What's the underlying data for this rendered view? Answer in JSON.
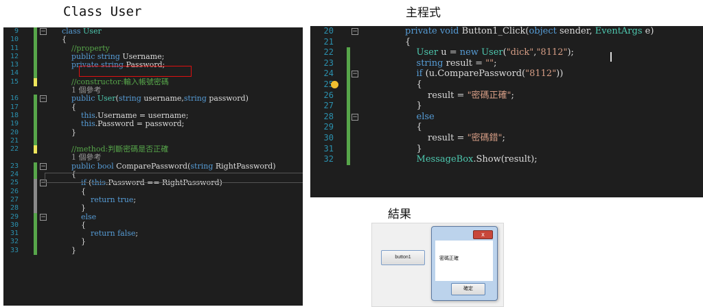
{
  "captions": {
    "left": "Class User",
    "right": "主程式",
    "result": "結果"
  },
  "left_editor": {
    "lines": [
      {
        "n": "9",
        "gutter": "green",
        "fold": "minus",
        "code": [
          [
            "k",
            "class "
          ],
          [
            "t",
            "User"
          ]
        ]
      },
      {
        "n": "10",
        "gutter": "green",
        "fold": "",
        "code": [
          [
            "p",
            "{"
          ]
        ]
      },
      {
        "n": "11",
        "gutter": "green",
        "fold": "",
        "code": [
          [
            "c",
            "    //property"
          ]
        ]
      },
      {
        "n": "12",
        "gutter": "green",
        "fold": "",
        "code": [
          [
            "k",
            "    public string "
          ],
          [
            "p",
            "Username;"
          ]
        ]
      },
      {
        "n": "13",
        "gutter": "green",
        "fold": "",
        "code": [
          [
            "k",
            "    private string "
          ],
          [
            "p",
            "Password;"
          ]
        ]
      },
      {
        "n": "14",
        "gutter": "green",
        "fold": "",
        "code": [
          [
            "p",
            ""
          ]
        ]
      },
      {
        "n": "15",
        "gutter": "yellow",
        "fold": "",
        "code": [
          [
            "c",
            "    //constructor:輸入帳號密碼"
          ]
        ]
      },
      {
        "n": "",
        "gutter": "",
        "fold": "",
        "code": [
          [
            "ref",
            "    1 個參考"
          ]
        ]
      },
      {
        "n": "16",
        "gutter": "green",
        "fold": "minus",
        "code": [
          [
            "k",
            "    public "
          ],
          [
            "t",
            "User"
          ],
          [
            "p",
            "("
          ],
          [
            "k",
            "string "
          ],
          [
            "p",
            "username,"
          ],
          [
            "k",
            "string "
          ],
          [
            "p",
            "password)"
          ]
        ]
      },
      {
        "n": "17",
        "gutter": "green",
        "fold": "",
        "code": [
          [
            "p",
            "    {"
          ]
        ]
      },
      {
        "n": "18",
        "gutter": "green",
        "fold": "",
        "code": [
          [
            "k",
            "        this"
          ],
          [
            "p",
            ".Username = username;"
          ]
        ]
      },
      {
        "n": "19",
        "gutter": "green",
        "fold": "",
        "code": [
          [
            "k",
            "        this"
          ],
          [
            "p",
            ".Password = password;"
          ]
        ]
      },
      {
        "n": "20",
        "gutter": "green",
        "fold": "",
        "code": [
          [
            "p",
            "    }"
          ]
        ]
      },
      {
        "n": "21",
        "gutter": "green",
        "fold": "",
        "code": [
          [
            "p",
            ""
          ]
        ]
      },
      {
        "n": "22",
        "gutter": "yellow",
        "fold": "",
        "code": [
          [
            "c",
            "    //method:判斷密碼是否正確"
          ]
        ]
      },
      {
        "n": "",
        "gutter": "",
        "fold": "",
        "code": [
          [
            "ref",
            "    1 個參考"
          ]
        ]
      },
      {
        "n": "23",
        "gutter": "green",
        "fold": "minus",
        "code": [
          [
            "k",
            "    public bool "
          ],
          [
            "p",
            "ComparePassword("
          ],
          [
            "k",
            "string "
          ],
          [
            "p",
            "RightPassword)"
          ]
        ]
      },
      {
        "n": "24",
        "gutter": "green",
        "fold": "",
        "code": [
          [
            "p",
            "    {"
          ]
        ]
      },
      {
        "n": "25",
        "gutter": "gray",
        "fold": "minus",
        "code": [
          [
            "k",
            "        if "
          ],
          [
            "p",
            "("
          ],
          [
            "k",
            "this"
          ],
          [
            "p",
            ".Password == RightPassword)"
          ]
        ]
      },
      {
        "n": "26",
        "gutter": "gray",
        "fold": "",
        "code": [
          [
            "p",
            "        {"
          ]
        ]
      },
      {
        "n": "27",
        "gutter": "gray",
        "fold": "",
        "code": [
          [
            "k",
            "            return true"
          ],
          [
            "p",
            ";"
          ]
        ]
      },
      {
        "n": "28",
        "gutter": "gray",
        "fold": "",
        "code": [
          [
            "p",
            "        }"
          ]
        ]
      },
      {
        "n": "29",
        "gutter": "green",
        "fold": "minus",
        "code": [
          [
            "k",
            "        else"
          ]
        ]
      },
      {
        "n": "30",
        "gutter": "green",
        "fold": "",
        "code": [
          [
            "p",
            "        {"
          ]
        ]
      },
      {
        "n": "31",
        "gutter": "green",
        "fold": "",
        "code": [
          [
            "k",
            "            return false"
          ],
          [
            "p",
            ";"
          ]
        ]
      },
      {
        "n": "32",
        "gutter": "green",
        "fold": "",
        "code": [
          [
            "p",
            "        }"
          ]
        ]
      },
      {
        "n": "33",
        "gutter": "green",
        "fold": "",
        "code": [
          [
            "p",
            "    }"
          ]
        ]
      }
    ]
  },
  "right_editor": {
    "lines": [
      {
        "n": "20",
        "gutter": "",
        "fold": "minus",
        "code": [
          [
            "k",
            "private void "
          ],
          [
            "p",
            "Button1_Click("
          ],
          [
            "k",
            "object "
          ],
          [
            "p",
            "sender, "
          ],
          [
            "t",
            "EventArgs "
          ],
          [
            "p",
            "e)"
          ]
        ]
      },
      {
        "n": "21",
        "gutter": "",
        "fold": "",
        "code": [
          [
            "p",
            "{"
          ]
        ]
      },
      {
        "n": "22",
        "gutter": "green",
        "fold": "",
        "code": [
          [
            "t",
            "    User "
          ],
          [
            "p",
            "u = "
          ],
          [
            "k",
            "new "
          ],
          [
            "t",
            "User"
          ],
          [
            "p",
            "("
          ],
          [
            "s",
            "\"dick\""
          ],
          [
            "p",
            ","
          ],
          [
            "s",
            "\"8112\""
          ],
          [
            "p",
            ");"
          ]
        ]
      },
      {
        "n": "23",
        "gutter": "green",
        "fold": "",
        "code": [
          [
            "k",
            "    string "
          ],
          [
            "p",
            "result = "
          ],
          [
            "s",
            "\"\""
          ],
          [
            "p",
            ";"
          ]
        ]
      },
      {
        "n": "24",
        "gutter": "green",
        "fold": "minus",
        "code": [
          [
            "k",
            "    if "
          ],
          [
            "p",
            "(u.ComparePassword("
          ],
          [
            "s",
            "\"8112\""
          ],
          [
            "p",
            "))"
          ]
        ]
      },
      {
        "n": "25",
        "gutter": "green",
        "fold": "",
        "code": [
          [
            "p",
            "    {"
          ]
        ]
      },
      {
        "n": "26",
        "gutter": "green",
        "fold": "",
        "code": [
          [
            "p",
            "        result = "
          ],
          [
            "s",
            "\"密碼正確\""
          ],
          [
            "p",
            ";"
          ]
        ]
      },
      {
        "n": "27",
        "gutter": "green",
        "fold": "",
        "code": [
          [
            "p",
            "    }"
          ]
        ]
      },
      {
        "n": "28",
        "gutter": "green",
        "fold": "minus",
        "code": [
          [
            "k",
            "    else"
          ]
        ]
      },
      {
        "n": "29",
        "gutter": "green",
        "fold": "",
        "code": [
          [
            "p",
            "    {"
          ]
        ]
      },
      {
        "n": "30",
        "gutter": "green",
        "fold": "",
        "code": [
          [
            "p",
            "        result = "
          ],
          [
            "s",
            "\"密碼錯\""
          ],
          [
            "p",
            ";"
          ]
        ]
      },
      {
        "n": "31",
        "gutter": "green",
        "fold": "",
        "code": [
          [
            "p",
            "    }"
          ]
        ]
      },
      {
        "n": "32",
        "gutter": "green",
        "fold": "",
        "code": [
          [
            "t",
            "    MessageBox"
          ],
          [
            "p",
            ".Show(result);"
          ]
        ]
      }
    ]
  },
  "result_window": {
    "button_label": "button1",
    "message": "密碼正確",
    "ok_label": "確定",
    "close_glyph": "x"
  },
  "colors": {
    "editor_bg": "#1e1e1e",
    "keyword": "#569cd6",
    "type": "#4ec9b0",
    "string": "#d69d85",
    "comment": "#57a64a",
    "gutter_green": "#57a64a",
    "gutter_yellow": "#efe65b",
    "gutter_gray": "#8a8a8a"
  }
}
